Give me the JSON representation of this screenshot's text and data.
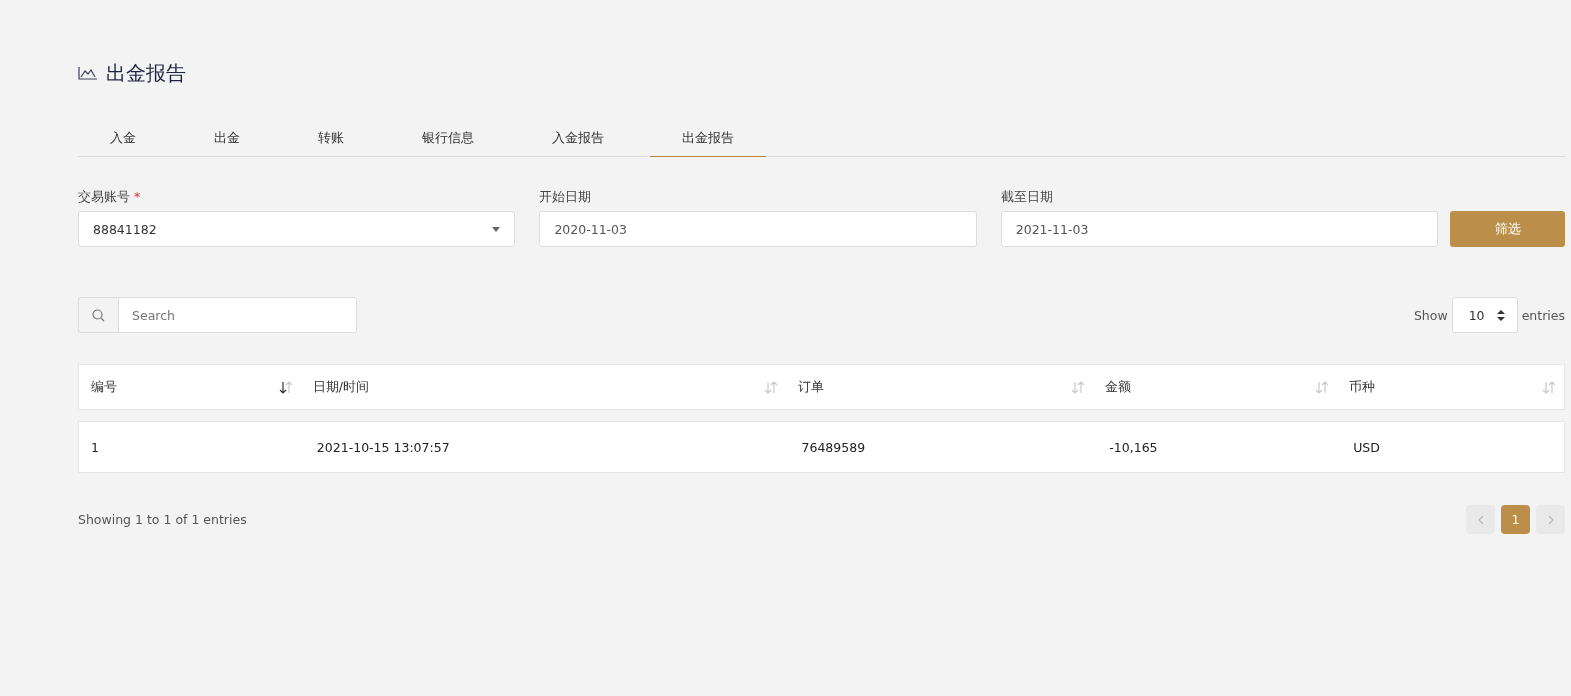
{
  "page_title": "出金报告",
  "tabs": [
    {
      "label": "入金",
      "selected": false
    },
    {
      "label": "出金",
      "selected": false
    },
    {
      "label": "转账",
      "selected": false
    },
    {
      "label": "银行信息",
      "selected": false
    },
    {
      "label": "入金报告",
      "selected": false
    },
    {
      "label": "出金报告",
      "selected": true
    }
  ],
  "filters": [
    {
      "kind": "select",
      "label": "交易账号",
      "required_mark": "*",
      "value": "88841182"
    },
    {
      "kind": "date",
      "label": "开始日期",
      "value": "2020-11-03"
    },
    {
      "kind": "date",
      "label": "截至日期",
      "value": "2021-11-03"
    }
  ],
  "filter_button": "筛选",
  "search": {
    "placeholder": "Search"
  },
  "page_length": {
    "prefix": "Show",
    "value": "10",
    "suffix": "entries"
  },
  "table": {
    "columns": [
      {
        "label": "编号",
        "sorted": true
      },
      {
        "label": "日期/时间",
        "sorted": false
      },
      {
        "label": "订单",
        "sorted": false
      },
      {
        "label": "金额",
        "sorted": false
      },
      {
        "label": "币种",
        "sorted": false
      }
    ],
    "rows": [
      [
        "1",
        "2021-10-15 13:07:57",
        "76489589",
        "-10,165",
        "USD"
      ]
    ]
  },
  "info": "Showing 1 to 1 of 1 entries",
  "pagination": {
    "previous_disabled": true,
    "pages": [
      {
        "label": "1",
        "selected": true
      }
    ],
    "next_disabled": true
  }
}
